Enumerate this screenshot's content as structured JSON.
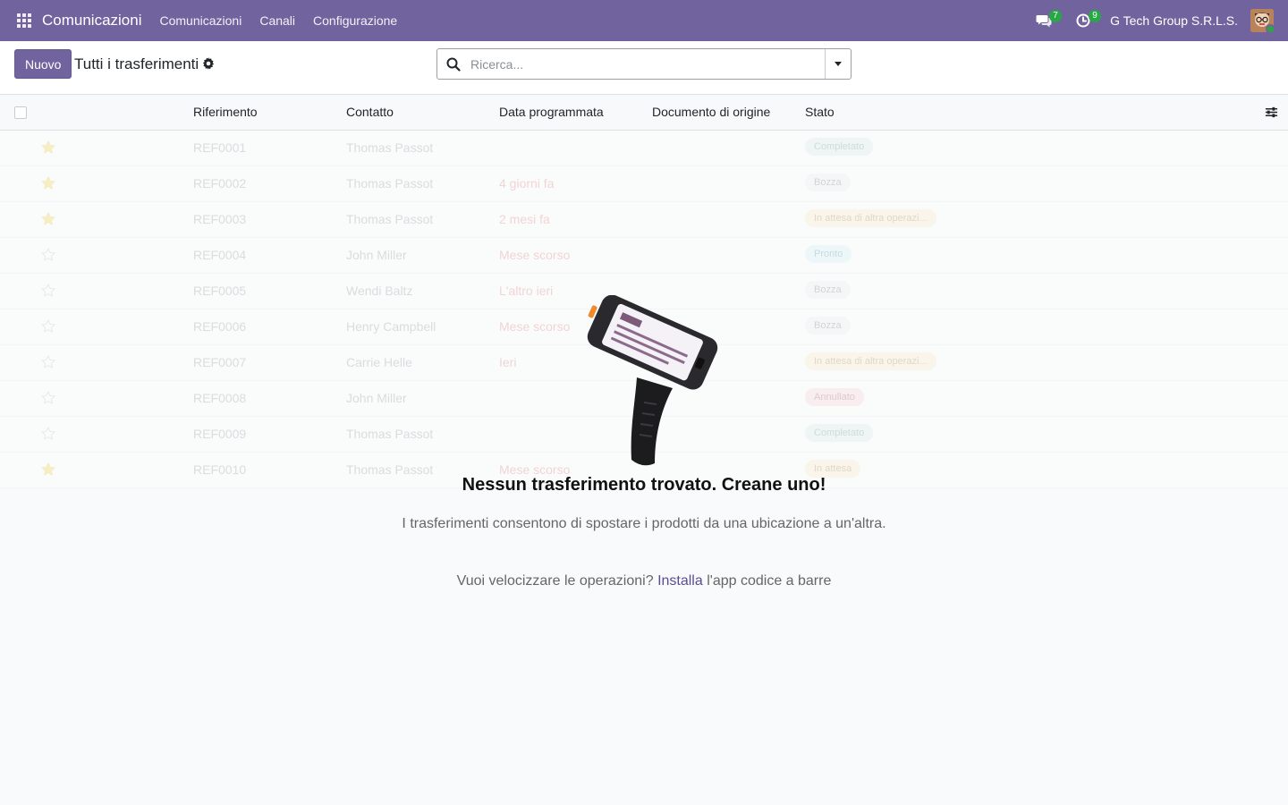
{
  "navbar": {
    "app_name": "Comunicazioni",
    "menu": [
      "Comunicazioni",
      "Canali",
      "Configurazione"
    ],
    "messages_count": "7",
    "activities_count": "9",
    "company": "G Tech Group S.R.L.S.",
    "colors": {
      "background": "#71639e",
      "badge": "#28a745"
    }
  },
  "control_panel": {
    "new_button": "Nuovo",
    "title": "Tutti i trasferimenti",
    "search_placeholder": "Ricerca..."
  },
  "list": {
    "columns": [
      "Riferimento",
      "Contatto",
      "Data programmata",
      "Documento di origine",
      "Stato"
    ],
    "rows": [
      {
        "starred": true,
        "ref": "REF0001",
        "contact": "Thomas Passot",
        "date": "",
        "status": "Completato",
        "status_style": "success"
      },
      {
        "starred": true,
        "ref": "REF0002",
        "contact": "Thomas Passot",
        "date": "4 giorni fa",
        "status": "Bozza",
        "status_style": "draft"
      },
      {
        "starred": true,
        "ref": "REF0003",
        "contact": "Thomas Passot",
        "date": "2 mesi fa",
        "status": "In attesa di altra operazi...",
        "status_style": "warning"
      },
      {
        "starred": false,
        "ref": "REF0004",
        "contact": "John Miller",
        "date": "Mese scorso",
        "status": "Pronto",
        "status_style": "info"
      },
      {
        "starred": false,
        "ref": "REF0005",
        "contact": "Wendi Baltz",
        "date": "L'altro ieri",
        "status": "Bozza",
        "status_style": "draft"
      },
      {
        "starred": false,
        "ref": "REF0006",
        "contact": "Henry Campbell",
        "date": "Mese scorso",
        "status": "Bozza",
        "status_style": "draft"
      },
      {
        "starred": false,
        "ref": "REF0007",
        "contact": "Carrie Helle",
        "date": "Ieri",
        "status": "In attesa di altra operazi...",
        "status_style": "warning"
      },
      {
        "starred": false,
        "ref": "REF0008",
        "contact": "John Miller",
        "date": "",
        "status": "Annullato",
        "status_style": "danger"
      },
      {
        "starred": false,
        "ref": "REF0009",
        "contact": "Thomas Passot",
        "date": "",
        "status": "Completato",
        "status_style": "success"
      },
      {
        "starred": true,
        "ref": "REF0010",
        "contact": "Thomas Passot",
        "date": "Mese scorso",
        "status": "In attesa",
        "status_style": "warning"
      }
    ]
  },
  "helper": {
    "title": "Nessun trasferimento trovato. Creane uno!",
    "description": "I trasferimenti consentono di spostare i prodotti da una ubicazione a un'altra.",
    "cta_prefix": "Vuoi velocizzare le operazioni?",
    "cta_link": "Installa",
    "cta_suffix": "l'app codice a barre"
  }
}
